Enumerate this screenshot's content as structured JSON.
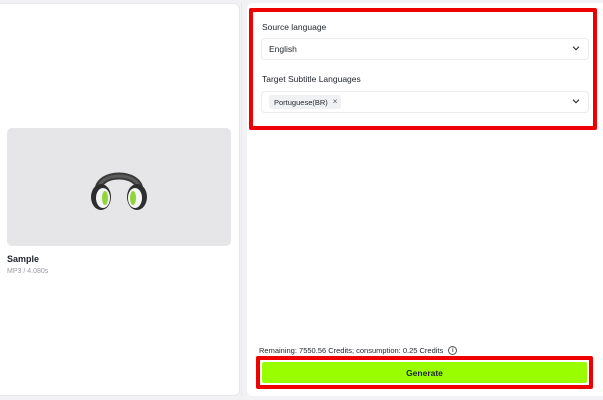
{
  "media": {
    "name": "Sample",
    "meta": "MP3 / 4.080s",
    "thumbnail_icon": "headphones-icon",
    "accent_color": "#8ed63a"
  },
  "settings": {
    "source_language": {
      "label": "Source language",
      "value": "English"
    },
    "target_languages": {
      "label": "Target Subtitle Languages",
      "selected": [
        "Portuguese(BR)"
      ]
    }
  },
  "footer": {
    "credits_text": "Remaining: 7550.56 Credits; consumption: 0.25 Credits",
    "generate_label": "Generate",
    "generate_color": "#99ff00"
  }
}
